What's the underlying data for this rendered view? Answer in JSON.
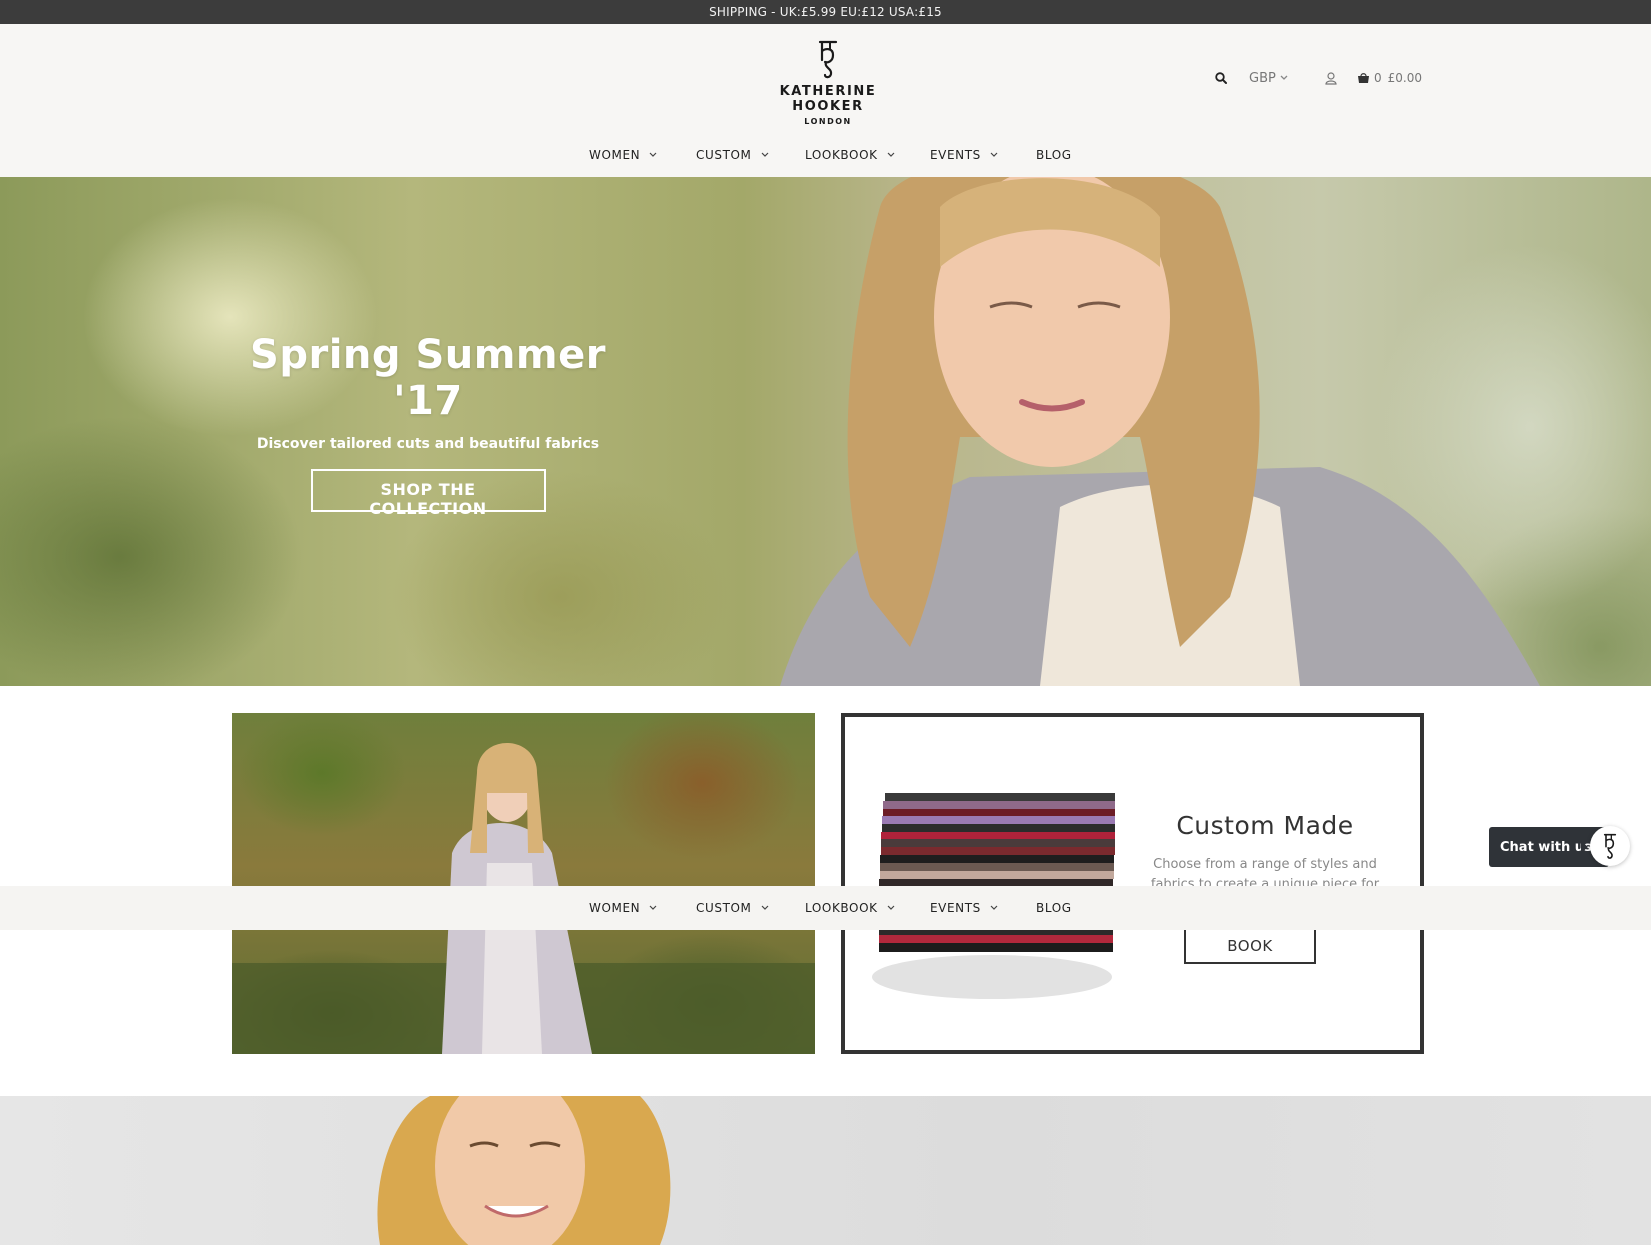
{
  "shipping_bar": {
    "text": "SHIPPING - UK:£5.99 EU:£12 USA:£15"
  },
  "brand": {
    "name": "KATHERINE HOOKER",
    "sub": "LONDON",
    "logo_icon": "kh-monogram-icon"
  },
  "utility": {
    "search_icon": "search-icon",
    "currency": "GBP",
    "account_icon": "user-icon",
    "cart_icon": "shopping-bag-icon",
    "cart_count": "0",
    "cart_total": "£0.00"
  },
  "nav": {
    "items": [
      {
        "label": "WOMEN",
        "has_dropdown": true
      },
      {
        "label": "CUSTOM",
        "has_dropdown": true
      },
      {
        "label": "LOOKBOOK",
        "has_dropdown": true
      },
      {
        "label": "EVENTS",
        "has_dropdown": true
      },
      {
        "label": "BLOG",
        "has_dropdown": false
      }
    ]
  },
  "hero": {
    "title": "Spring Summer '17",
    "subtitle": "Discover tailored cuts and beautiful fabrics",
    "button": "SHOP THE COLLECTION"
  },
  "custom_card": {
    "title": "Custom Made",
    "desc_line1": "Choose from a range of styles and",
    "desc_line2": "fabrics to create a unique piece for",
    "button": "BOOK"
  },
  "chat": {
    "label": "Chat with us!"
  },
  "colors": {
    "topbar": "#3c3c3c",
    "header_bg": "#f7f6f4",
    "chat_bg": "#2f3338",
    "card_border": "#333333"
  }
}
